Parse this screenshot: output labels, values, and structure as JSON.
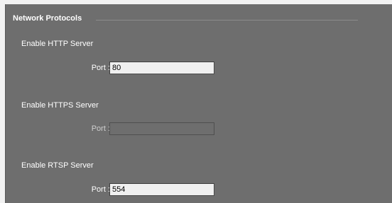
{
  "section": {
    "title": "Network Protocols"
  },
  "http": {
    "label": "Enable HTTP Server",
    "port_label": "Port :",
    "port_value": "80"
  },
  "https": {
    "label": "Enable HTTPS Server",
    "port_label": "Port :",
    "port_value": ""
  },
  "rtsp": {
    "label": "Enable RTSP Server",
    "port_label": "Port :",
    "port_value": "554"
  }
}
